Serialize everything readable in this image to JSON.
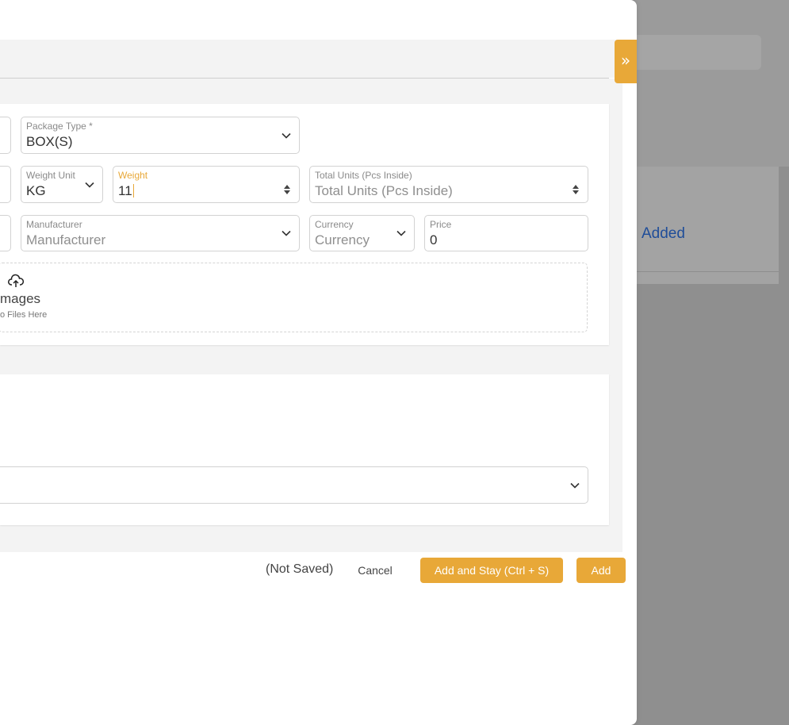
{
  "background": {
    "status_link": "Added"
  },
  "form": {
    "package_type": {
      "label": "Package Type *",
      "value": "BOX(S)"
    },
    "weight_unit": {
      "label": "Weight Unit",
      "value": "KG"
    },
    "weight": {
      "label": "Weight",
      "value": "11"
    },
    "total_units": {
      "label": "Total Units (Pcs Inside)",
      "placeholder": "Total Units (Pcs Inside)"
    },
    "manufacturer": {
      "label": "Manufacturer",
      "placeholder": "Manufacturer"
    },
    "currency": {
      "label": "Currency",
      "placeholder": "Currency"
    },
    "price": {
      "label": "Price",
      "value": "0"
    },
    "upload": {
      "title": "mages",
      "subtitle": "o Files Here"
    }
  },
  "footer": {
    "status": "(Not Saved)",
    "cancel_label": "Cancel",
    "add_stay_label": "Add and Stay (Ctrl + S)",
    "add_label": "Add"
  },
  "toggle": {
    "icon": "double-chevron-right-icon",
    "glyph": "»"
  },
  "colors": {
    "accent": "#e8a838",
    "link": "#1f4d99"
  }
}
